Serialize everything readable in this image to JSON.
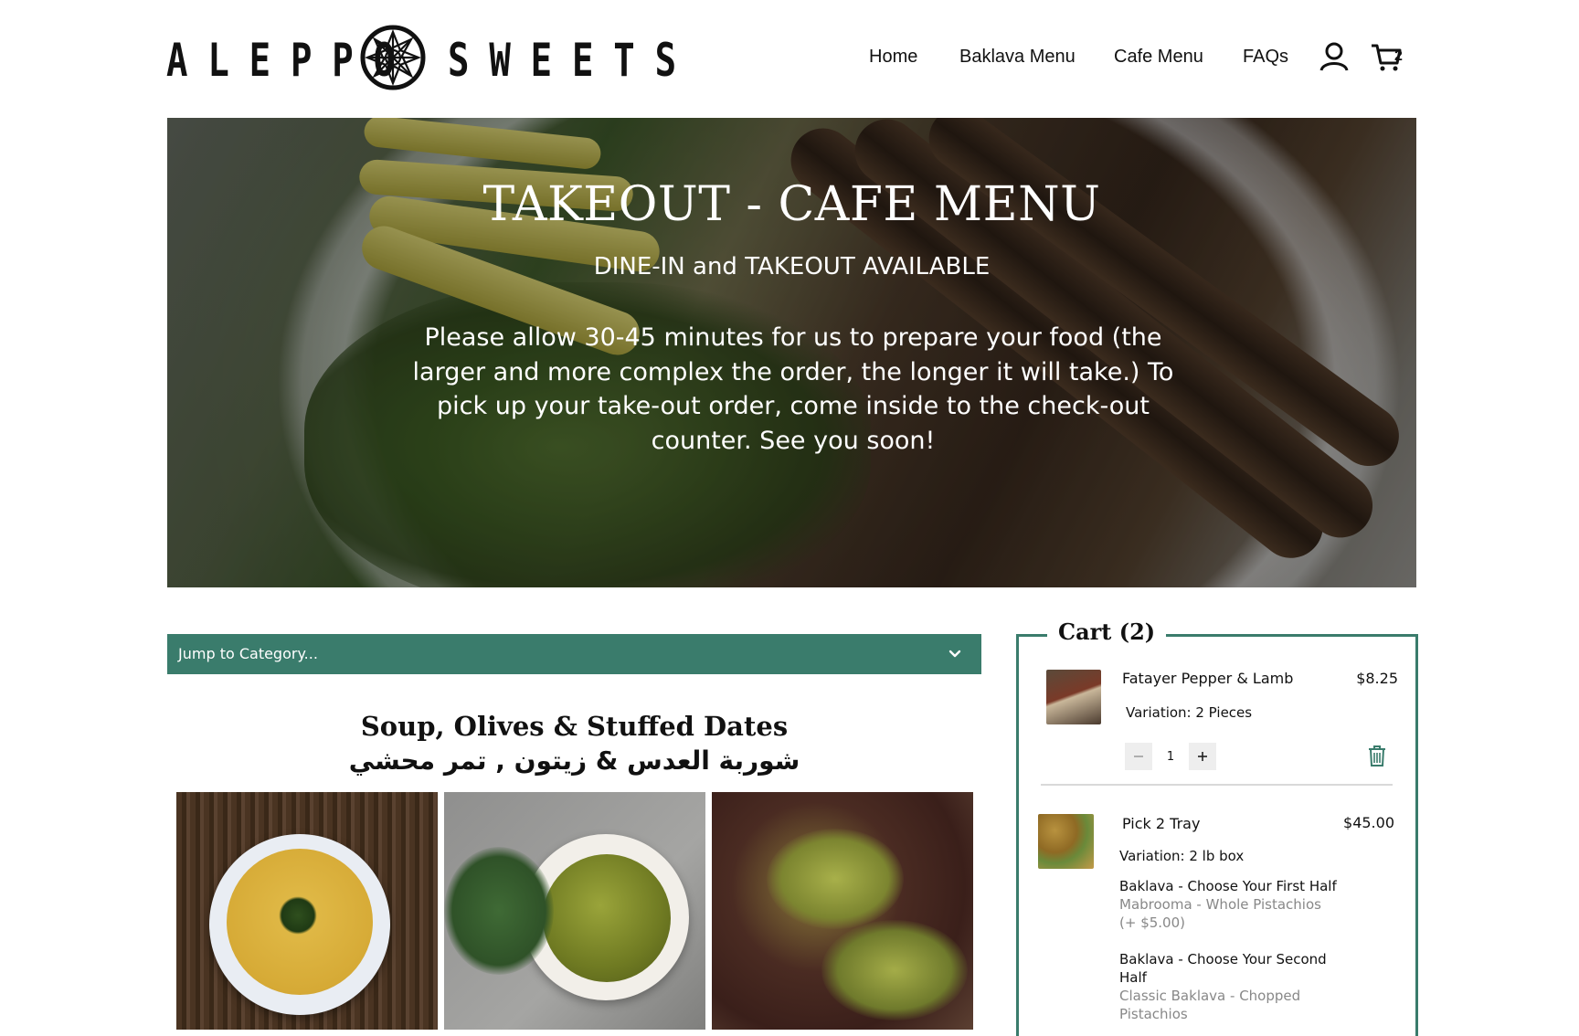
{
  "brand": {
    "left": "ALEPPO",
    "right": "SWEETS"
  },
  "nav": {
    "home": "Home",
    "baklava_menu": "Baklava Menu",
    "cafe_menu": "Cafe Menu",
    "faqs": "FAQs",
    "cart_count": "2"
  },
  "hero": {
    "title": "TAKEOUT - CAFE MENU",
    "subtitle": "DINE-IN and TAKEOUT AVAILABLE",
    "body": "Please allow 30-45 minutes for us to prepare your food (the larger and more complex the order, the longer it will take.) To pick up your take-out order, come inside to the check-out counter. See you soon!"
  },
  "jump": {
    "label": "Jump to Category..."
  },
  "category": {
    "title": "Soup, Olives & Stuffed Dates",
    "title_ar": "شوربة العدس & زيتون , تمر محشي"
  },
  "cart": {
    "legend": "Cart (2)",
    "items": [
      {
        "name": "Fatayer Pepper & Lamb",
        "price": "$8.25",
        "variation": "Variation: 2 Pieces",
        "qty": "1"
      },
      {
        "name": "Pick 2 Tray",
        "price": "$45.00",
        "variation": "Variation: 2 lb box",
        "options": [
          {
            "label": "Baklava - Choose Your First Half",
            "value": "Mabrooma - Whole Pistachios (+ $5.00)"
          },
          {
            "label": "Baklava - Choose Your Second Half",
            "value": "Classic Baklava - Chopped Pistachios"
          }
        ]
      }
    ]
  },
  "colors": {
    "accent": "#3a7c6c"
  },
  "icons": [
    "logo-star-icon",
    "user-icon",
    "cart-icon",
    "chevron-down-icon",
    "minus-icon",
    "plus-icon",
    "trash-icon"
  ]
}
